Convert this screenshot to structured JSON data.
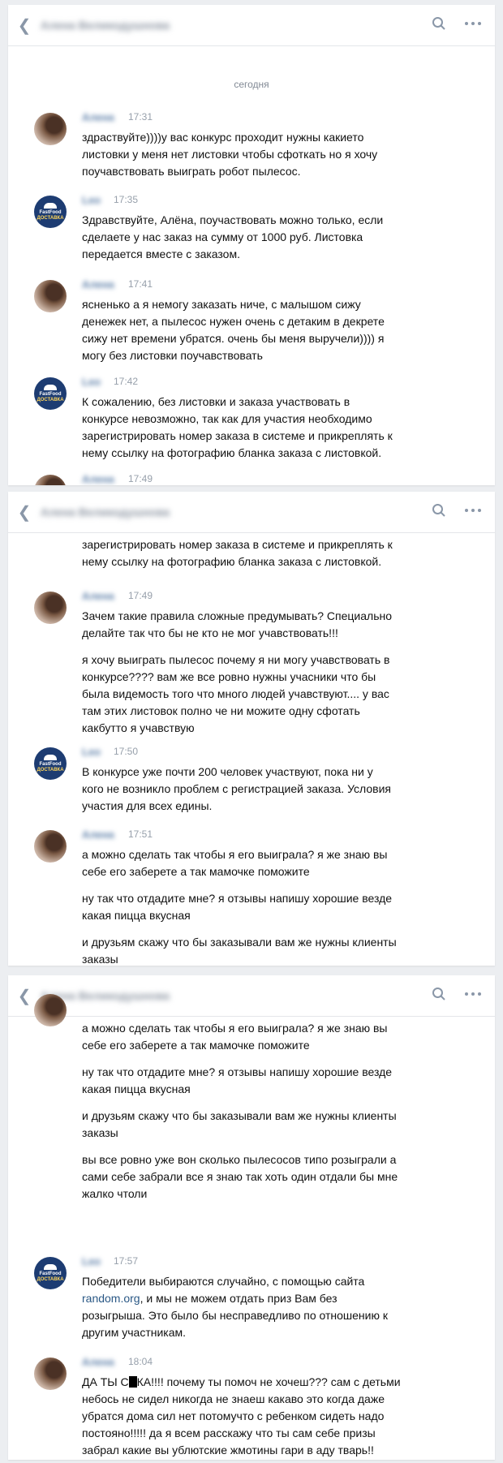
{
  "app": {
    "back_icon": "chevron-left-icon",
    "search_icon": "search-icon",
    "more_icon": "more-dots-icon",
    "accent": "#2a5885"
  },
  "chat": {
    "date_separator": "сегодня"
  },
  "panels": [
    {
      "messages": [
        {
          "time": "17:31",
          "lines": [
            "здраствуйте))))у вас конкурс проходит нужны какието",
            "листовки у меня нет листовки чтобы сфоткать но я хочу",
            "поучавствовать выиграть робот пылесос."
          ]
        },
        {
          "time": "17:35",
          "lines": [
            "Здравствуйте, Алёна, поучаствовать можно только, если",
            "сделаете у нас заказ на сумму от 1000 руб. Листовка",
            "передается вместе с заказом."
          ]
        },
        {
          "time": "17:41",
          "lines": [
            "ясненько а я немогу заказать ниче, с малышом сижу",
            "денежек нет, а пылесос нужен очень с детаким в декрете",
            "сижу нет времени убратся. очень бы меня выручели)))) я",
            "могу без листовки поучавствовать"
          ]
        },
        {
          "time": "17:42",
          "lines": [
            "К сожалению, без листовки и заказа участвовать в",
            "конкурсе невозможно, так как для участия необходимо",
            "зарегистрировать номер заказа в системе и прикреплять к",
            "нему ссылку на фотографию бланка заказа с листовкой."
          ]
        },
        {
          "time": "17:49"
        }
      ]
    },
    {
      "continued_lines": [
        "зарегистрировать номер заказа в системе и прикреплять к",
        "нему ссылку на фотографию бланка заказа с листовкой."
      ],
      "messages": [
        {
          "time": "17:49",
          "lines": [
            "Зачем такие правила сложные предумывать? Специально",
            "делайте так что бы не кто не мог учавствовать!!!",
            "",
            "я хочу выиграть пылесос почему я ни могу учавствовать в",
            "конкурсе???? вам же все ровно нужны учасники что бы",
            "была видемость того что много людей учавствуют.... у вас",
            "там этих листовок полно че ни можите одну сфотать",
            "какбутто я учавствую"
          ]
        },
        {
          "time": "17:50",
          "lines": [
            "В конкурсе уже почти 200 человек участвуют, пока ни у",
            "кого не возникло проблем с регистрацией заказа. Условия",
            "участия для всех едины."
          ]
        },
        {
          "time": "17:51",
          "lines": [
            "а можно сделать так чтобы я его выиграла? я же знаю вы",
            "себе его заберете а так мамочке поможите",
            "",
            "ну так что отдадите мне? я отзывы напишу хорошие везде",
            "какая пицца вкусная",
            "",
            "и друзьям скажу что бы заказывали вам же нужны клиенты",
            "заказы"
          ]
        }
      ]
    },
    {
      "continued_lines": [
        "а можно сделать так чтобы я его выиграла? я же знаю вы",
        "себе его заберете а так мамочке поможите",
        "",
        "ну так что отдадите мне? я отзывы напишу хорошие везде",
        "какая пицца вкусная",
        "",
        "и друзьям скажу что бы заказывали вам же нужны клиенты",
        "заказы",
        "",
        "вы все ровно уже вон сколько пылесосов типо розыграли а",
        "сами себе забрали все я знаю так хоть один отдали бы мне",
        "жалко чтоли"
      ],
      "messages": [
        {
          "time": "17:57",
          "line1_before": "Победители выбираются случайно, с помощью сайта",
          "link": "random.org",
          "line2_after": ", и мы не можем отдать приз Вам без",
          "lines": [
            "розыгрыша. Это было бы несправедливо по отношению к",
            "другим участникам."
          ]
        },
        {
          "time": "18:04",
          "first_pre": "ДА ТЫ С",
          "first_post": "КА!!!! почему ты помоч не хочеш??? сам с детьми",
          "lines": [
            "небось не сидел никогда не знаеш какаво это когда даже",
            "убратся дома сил нет потомучто с ребенком сидеть надо",
            "постояно!!!!! да я всем расскажу что ты сам себе призы",
            "забрал какие вы ублютские жмотины гари в аду тварь!!"
          ]
        }
      ]
    }
  ]
}
